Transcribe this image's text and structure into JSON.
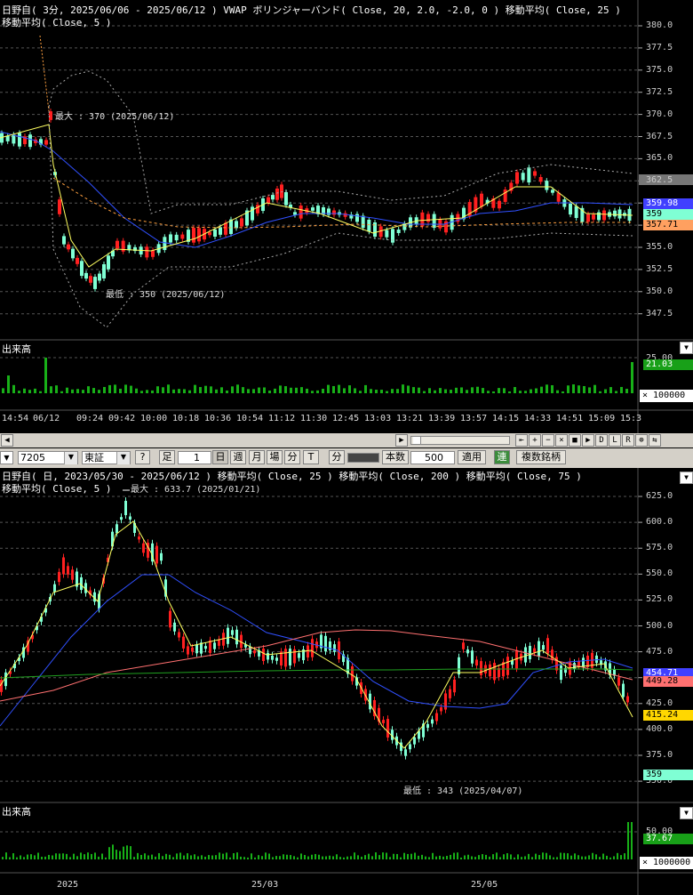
{
  "intraday": {
    "title_line1": "日野自( 3分, 2025/06/06 - 2025/06/12 )   VWAP   ボリンジャーバンド( Close, 20, 2.0, -2.0, 0 )   移動平均( Close, 25 )",
    "title_line2": "移動平均( Close, 5 )",
    "yticks": [
      "380.0",
      "377.5",
      "375.0",
      "372.5",
      "370.0",
      "367.5",
      "365.0",
      "362.5",
      "360.0",
      "357.5",
      "355.0",
      "352.5",
      "350.0",
      "347.5"
    ],
    "max_label": "最大 : 370 (2025/06/12)",
    "min_label": "最低 : 350 (2025/06/12)",
    "badges": [
      {
        "text": "359.98",
        "bg": "#4040ff",
        "fg": "#fff"
      },
      {
        "text": "359",
        "bg": "#7fffd4",
        "fg": "#000"
      },
      {
        "text": "357.71",
        "bg": "#ffa060",
        "fg": "#000"
      }
    ],
    "volume_label": "出来高",
    "vol_tick": "25.00",
    "vol_badge": "21.03",
    "vol_scale": "× 100000",
    "xticks": [
      "14:54",
      "06/12",
      "09:24",
      "09:42",
      "10:00",
      "10:18",
      "10:36",
      "10:54",
      "11:12",
      "11:30",
      "12:45",
      "13:03",
      "13:21",
      "13:39",
      "13:57",
      "14:15",
      "14:33",
      "14:51",
      "15:09",
      "15:3"
    ]
  },
  "toolbar": {
    "code": "7205",
    "market": "東証",
    "help": "?",
    "ashi": "足",
    "ashi_value": "1",
    "periods": [
      "日",
      "週",
      "月",
      "場",
      "分",
      "T"
    ],
    "fun": "分",
    "count_label": "本数",
    "count_value": "500",
    "apply": "適用",
    "ren": "連",
    "multi": "複数銘柄"
  },
  "scroll_buttons": [
    "⇤",
    "+",
    "−",
    "×",
    "■",
    "▶",
    "D",
    "L",
    "R",
    "⊕",
    "⇆"
  ],
  "daily": {
    "title_line1": "日野自( 日, 2023/05/30 - 2025/06/12 )   移動平均( Close, 25 )   移動平均( Close, 200 )   移動平均( Close, 75 )",
    "title_line2": "移動平均( Close, 5 )",
    "max_label": "最大 : 633.7 (2025/01/21)",
    "min_label": "最低 : 343 (2025/04/07)",
    "yticks": [
      "625.0",
      "600.0",
      "575.0",
      "550.0",
      "525.0",
      "500.0",
      "475.0",
      "450.0",
      "425.0",
      "400.0",
      "375.0",
      "350.0"
    ],
    "badges": [
      {
        "text": "454.71",
        "bg": "#4040ff",
        "fg": "#fff"
      },
      {
        "text": "449.28",
        "bg": "#ff7070",
        "fg": "#000"
      },
      {
        "text": "415.24",
        "bg": "#ffd700",
        "fg": "#000"
      },
      {
        "text": "359",
        "bg": "#7fffd4",
        "fg": "#000"
      }
    ],
    "volume_label": "出来高",
    "vol_tick": "50.00",
    "vol_badge": "37.67",
    "vol_scale": "× 1000000",
    "xticks": [
      "2025",
      "25/03",
      "25/05"
    ]
  }
}
